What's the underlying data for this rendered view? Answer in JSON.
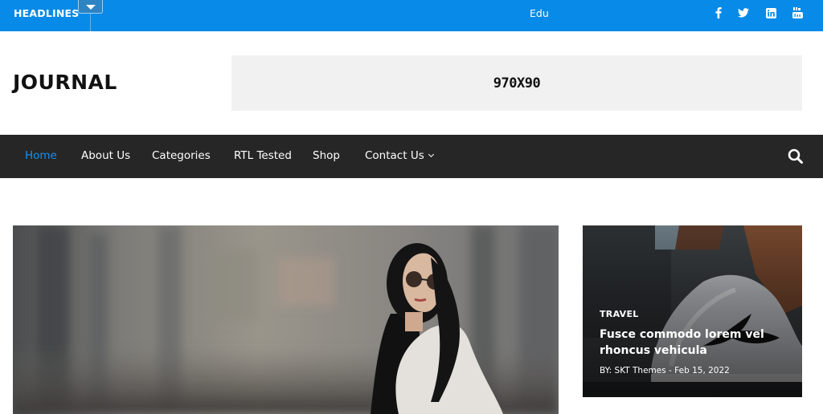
{
  "topbar": {
    "headlines_label": "HEADLINES",
    "ticker_text": "Edu",
    "social_icons": [
      "facebook-icon",
      "twitter-icon",
      "linkedin-icon",
      "youtube-icon"
    ],
    "colors": {
      "background": "#078ae8"
    }
  },
  "header": {
    "site_title": "JOURNAL",
    "ad_label": "970X90"
  },
  "nav": {
    "items": [
      {
        "label": "Home",
        "active": true
      },
      {
        "label": "About Us",
        "active": false
      },
      {
        "label": "Categories",
        "active": false
      },
      {
        "label": "RTL Tested",
        "active": false
      },
      {
        "label": "Shop",
        "active": false
      },
      {
        "label": "Contact Us",
        "active": false,
        "has_dropdown": true
      }
    ],
    "search_icon": "search-icon",
    "colors": {
      "background": "#262626",
      "active": "#1a8ff0"
    }
  },
  "featured": {
    "hero_image": "woman-sunglasses-photo",
    "side_card": {
      "category": "TRAVEL",
      "title": "Fusce commodo lorem vel rhoncus vehicula",
      "meta": "BY: SKT Themes - Feb 15, 2022",
      "image": "sneaker-photo"
    }
  }
}
